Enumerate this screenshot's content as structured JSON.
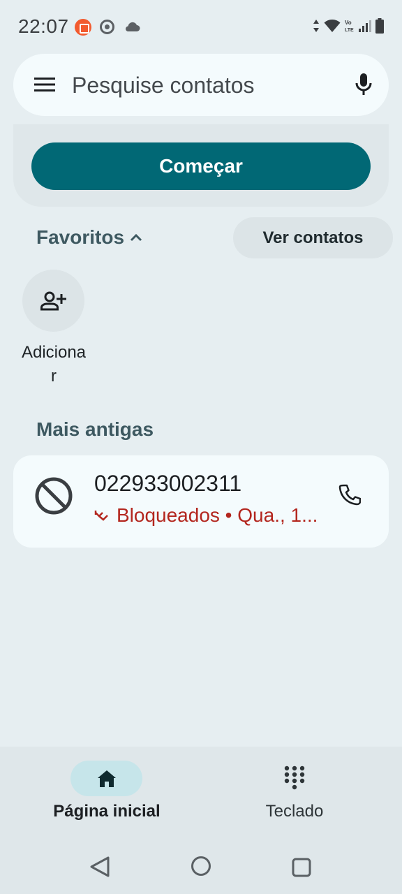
{
  "status_bar": {
    "time": "22:07",
    "icons": [
      "shopee-icon",
      "chrome-icon",
      "cloud-icon",
      "data-arrows-icon",
      "wifi-icon",
      "volte-icon",
      "signal-icon",
      "battery-icon"
    ],
    "volte_text": "Vo\nLTE"
  },
  "search": {
    "placeholder": "Pesquise contatos"
  },
  "start_card": {
    "button_label": "Começar"
  },
  "favorites": {
    "title": "Favoritos",
    "view_contacts_label": "Ver contatos",
    "add_label": "Adicionar"
  },
  "recent": {
    "section_title": "Mais antigas",
    "calls": [
      {
        "number": "022933002311",
        "detail": "Bloqueados • Qua., 1..."
      }
    ]
  },
  "bottom_nav": {
    "home_label": "Página inicial",
    "keypad_label": "Teclado"
  },
  "colors": {
    "accent": "#016875",
    "blocked_red": "#b3261e",
    "background": "#e6eef1"
  }
}
